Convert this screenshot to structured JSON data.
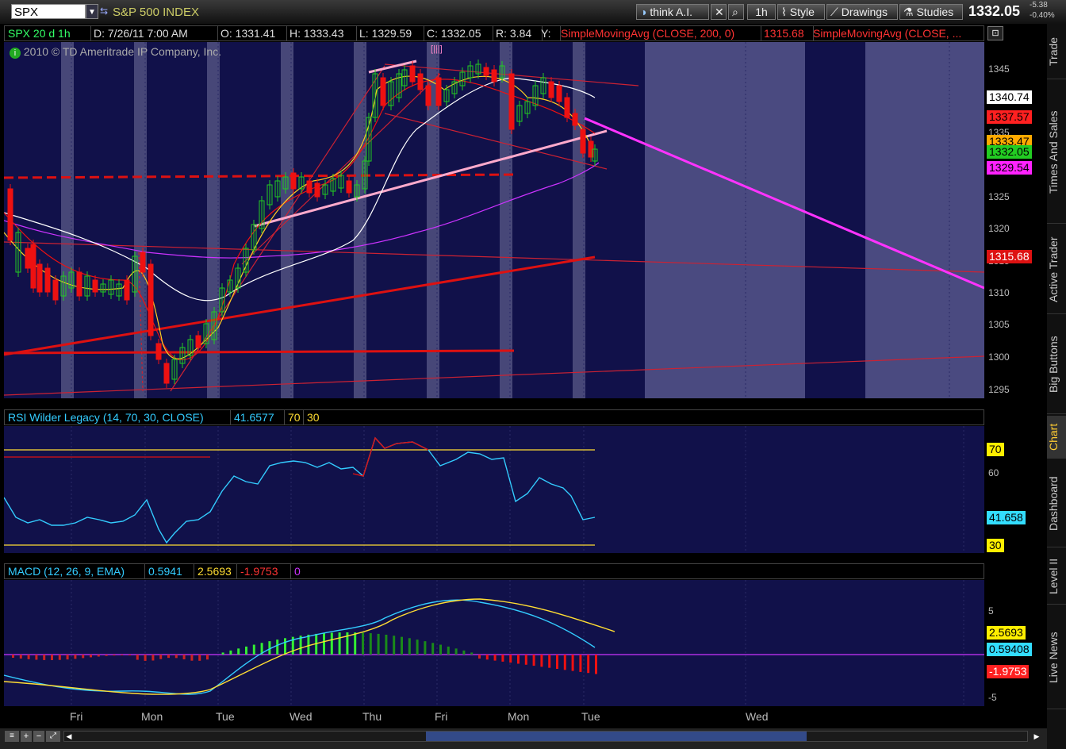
{
  "toolbar": {
    "symbol": "SPX",
    "symbol_name": "S&P 500 INDEX",
    "think_ai": "think A.I.",
    "timeframe": "1h",
    "style": "Style",
    "drawings": "Drawings",
    "studies": "Studies",
    "last_price": "1332.05",
    "change": "-5.38",
    "change_pct": "-0.40%"
  },
  "header": {
    "period": "SPX 20 d 1h",
    "date": "D: 7/26/11 7:00 AM",
    "open": "O: 1331.41",
    "high": "H: 1333.43",
    "low": "L: 1329.59",
    "close": "C: 1332.05",
    "range": "R: 3.84",
    "y": "Y:",
    "sma1": "SimpleMovingAvg (CLOSE, 200, 0)",
    "sma1_val": "1315.68",
    "sma2": "SimpleMovingAvg (CLOSE, ..."
  },
  "copyright": "2010 © TD Ameritrade IP Company, Inc.",
  "price_axis": [
    "1345",
    "1340",
    "1335",
    "1330",
    "1325",
    "1320",
    "1315",
    "1310",
    "1305",
    "1300",
    "1295"
  ],
  "price_tags": [
    {
      "label": "1340.74",
      "bg": "#ffffff",
      "fg": "#000000"
    },
    {
      "label": "1337.57",
      "bg": "#ff2020",
      "fg": "#000000"
    },
    {
      "label": "1333.47",
      "bg": "#ffaa00",
      "fg": "#000000"
    },
    {
      "label": "1332.05",
      "bg": "#22cc22",
      "fg": "#000000"
    },
    {
      "label": "1329.54",
      "bg": "#ff22ff",
      "fg": "#000000"
    },
    {
      "label": "1315.68",
      "bg": "#dd1111",
      "fg": "#ffffff"
    }
  ],
  "rsi": {
    "title": "RSI Wilder Legacy (14, 70, 30, CLOSE)",
    "value": "41.6577",
    "ob": "70",
    "os": "30",
    "axis": [
      "60"
    ],
    "tag_ob": "70",
    "tag_val": "41.658",
    "tag_os": "30"
  },
  "macd": {
    "title": "MACD (12, 26, 9, EMA)",
    "value": "0.5941",
    "avg": "2.5693",
    "diff": "-1.9753",
    "zero": "0",
    "axis_hi": "5",
    "axis_lo": "-5",
    "tag_avg": "2.5693",
    "tag_val": "0.59408",
    "tag_diff": "-1.9753"
  },
  "x_axis": [
    "Fri",
    "Mon",
    "Tue",
    "Wed",
    "Thu",
    "Fri",
    "Mon",
    "Tue",
    "Wed"
  ],
  "right_tabs": [
    "Trade",
    "Times And Sales",
    "Active Trader",
    "Big Buttons",
    "Chart",
    "Dashboard",
    "Level II",
    "Live News"
  ],
  "colors": {
    "bg": "#11114a",
    "grid_shade": "#474778",
    "future_bg": "#4a4a80",
    "up": "#22cc22",
    "down": "#ee1111",
    "rsi_line": "#33ccff",
    "macd_line": "#33ccff",
    "macd_avg": "#ffdd33",
    "trend_pink": "#ff33ff"
  }
}
